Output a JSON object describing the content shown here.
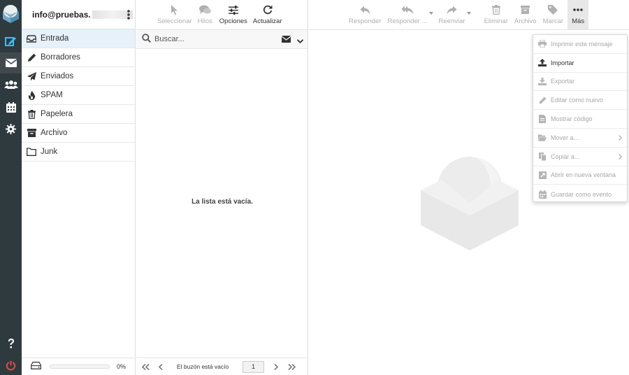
{
  "account": {
    "email": "info@pruebas."
  },
  "folders": [
    {
      "label": "Entrada",
      "icon": "inbox-icon",
      "selected": true
    },
    {
      "label": "Borradores",
      "icon": "pencil-icon"
    },
    {
      "label": "Enviados",
      "icon": "paper-plane-icon"
    },
    {
      "label": "SPAM",
      "icon": "fire-icon"
    },
    {
      "label": "Papelera",
      "icon": "trash-icon"
    },
    {
      "label": "Archivo",
      "icon": "archive-icon"
    },
    {
      "label": "Junk",
      "icon": "folder-icon"
    }
  ],
  "quota": {
    "percent_label": "0%",
    "fraction": 0
  },
  "list_toolbar": {
    "select": "Seleccionar",
    "threads": "Hilos",
    "options": "Opciones",
    "refresh": "Actualizar"
  },
  "search": {
    "placeholder": "Buscar..."
  },
  "list": {
    "empty_message": "La lista está vacía."
  },
  "pager": {
    "status": "El buzón está vacío",
    "page": "1"
  },
  "message_toolbar": {
    "reply": "Responder",
    "reply_all": "Responder ...",
    "forward": "Reenviar",
    "delete": "Eliminar",
    "archive": "Archivo",
    "mark": "Marcar",
    "more": "Más"
  },
  "more_menu": [
    {
      "label": "Imprimir este mensaje",
      "icon": "print-icon",
      "enabled": false
    },
    {
      "label": "Importar",
      "icon": "upload-icon",
      "enabled": true
    },
    {
      "label": "Exportar",
      "icon": "download-icon",
      "enabled": false
    },
    {
      "label": "Editar como nuevo",
      "icon": "pencil-icon",
      "enabled": false
    },
    {
      "label": "Mostrar código",
      "icon": "code-icon",
      "enabled": false
    },
    {
      "label": "Mover a...",
      "icon": "folder-open-icon",
      "enabled": false,
      "submenu": true
    },
    {
      "label": "Copiar a...",
      "icon": "copy-icon",
      "enabled": false,
      "submenu": true
    },
    {
      "label": "Abrir en nueva ventana",
      "icon": "external-window-icon",
      "enabled": false
    },
    {
      "label": "Guardar como evento",
      "icon": "calendar-icon",
      "enabled": false
    }
  ],
  "colors": {
    "rail": "#2f3a3f",
    "accent": "#37beff",
    "logout": "#e04a3f",
    "selected_folder": "#e6f1f9"
  }
}
